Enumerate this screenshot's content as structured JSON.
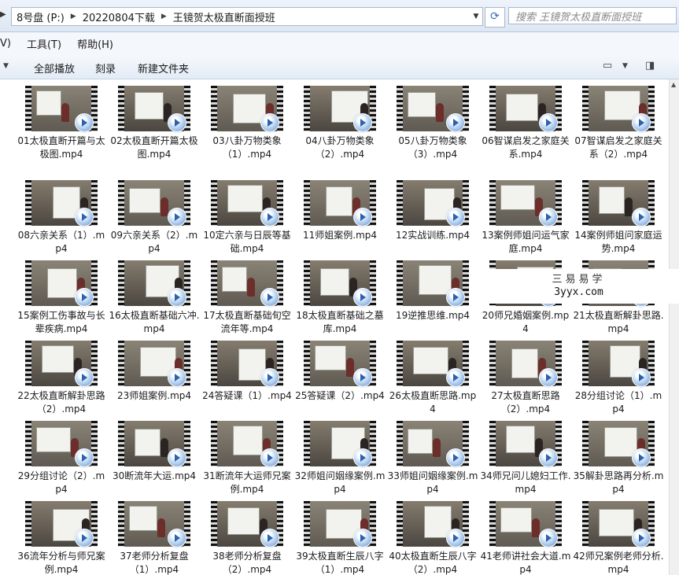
{
  "address_bar": {
    "crumbs": [
      "8号盘 (P:)",
      "20220804下载",
      "王镜贺太极直断面授班"
    ],
    "search_placeholder": "搜索 王镜贺太极直断面授班"
  },
  "menu": {
    "items": [
      "V)",
      "工具(T)",
      "帮助(H)"
    ]
  },
  "toolbar": {
    "play_all": "全部播放",
    "burn": "刻录",
    "new_folder": "新建文件夹"
  },
  "watermark": {
    "line1": "三易易学",
    "line2": "3yyx.com"
  },
  "files": [
    "01太极直断开篇与太极图.mp4",
    "02太极直断开篇太极图.mp4",
    "03八卦万物类象（1）.mp4",
    "04八卦万物类象（2）.mp4",
    "05八卦万物类象（3）.mp4",
    "06智谋启发之家庭关系.mp4",
    "07智谋启发之家庭关系（2）.mp4",
    "08六亲关系（1）.mp4",
    "09六亲关系（2）.mp4",
    "10定六亲与日辰等基础.mp4",
    "11师姐案例.mp4",
    "12实战训练.mp4",
    "13案例师姐问运气家庭.mp4",
    "14案例师姐问家庭运势.mp4",
    "15案例工伤事故与长辈疾病.mp4",
    "16太极直断基础六冲.mp4",
    "17太极直断基础旬空流年等.mp4",
    "18太极直断基础之墓库.mp4",
    "19逆推思维.mp4",
    "20师兄婚姻案例.mp4",
    "21太极直断解卦思路.mp4",
    "22太极直断解卦思路（2）.mp4",
    "23师姐案例.mp4",
    "24答疑课（1）.mp4",
    "25答疑课（2）.mp4",
    "26太极直断思路.mp4",
    "27太极直断思路（2）.mp4",
    "28分组讨论（1）.mp4",
    "29分组讨论（2）.mp4",
    "30断流年大运.mp4",
    "31断流年大运师兄案例.mp4",
    "32师姐问姻缘案例.mp4",
    "33师姐问姻缘案例.mp4",
    "34师兄问儿媳妇工作.mp4",
    "35解卦思路再分析.mp4",
    "36流年分析与师兄案例.mp4",
    "37老师分析复盘（1）.mp4",
    "38老师分析复盘（2）.mp4",
    "39太极直断生辰八字（1）.mp4",
    "40太极直断生辰八字（2）.mp4",
    "41老师讲社会大道.mp4",
    "42师兄案例老师分析.mp4"
  ]
}
